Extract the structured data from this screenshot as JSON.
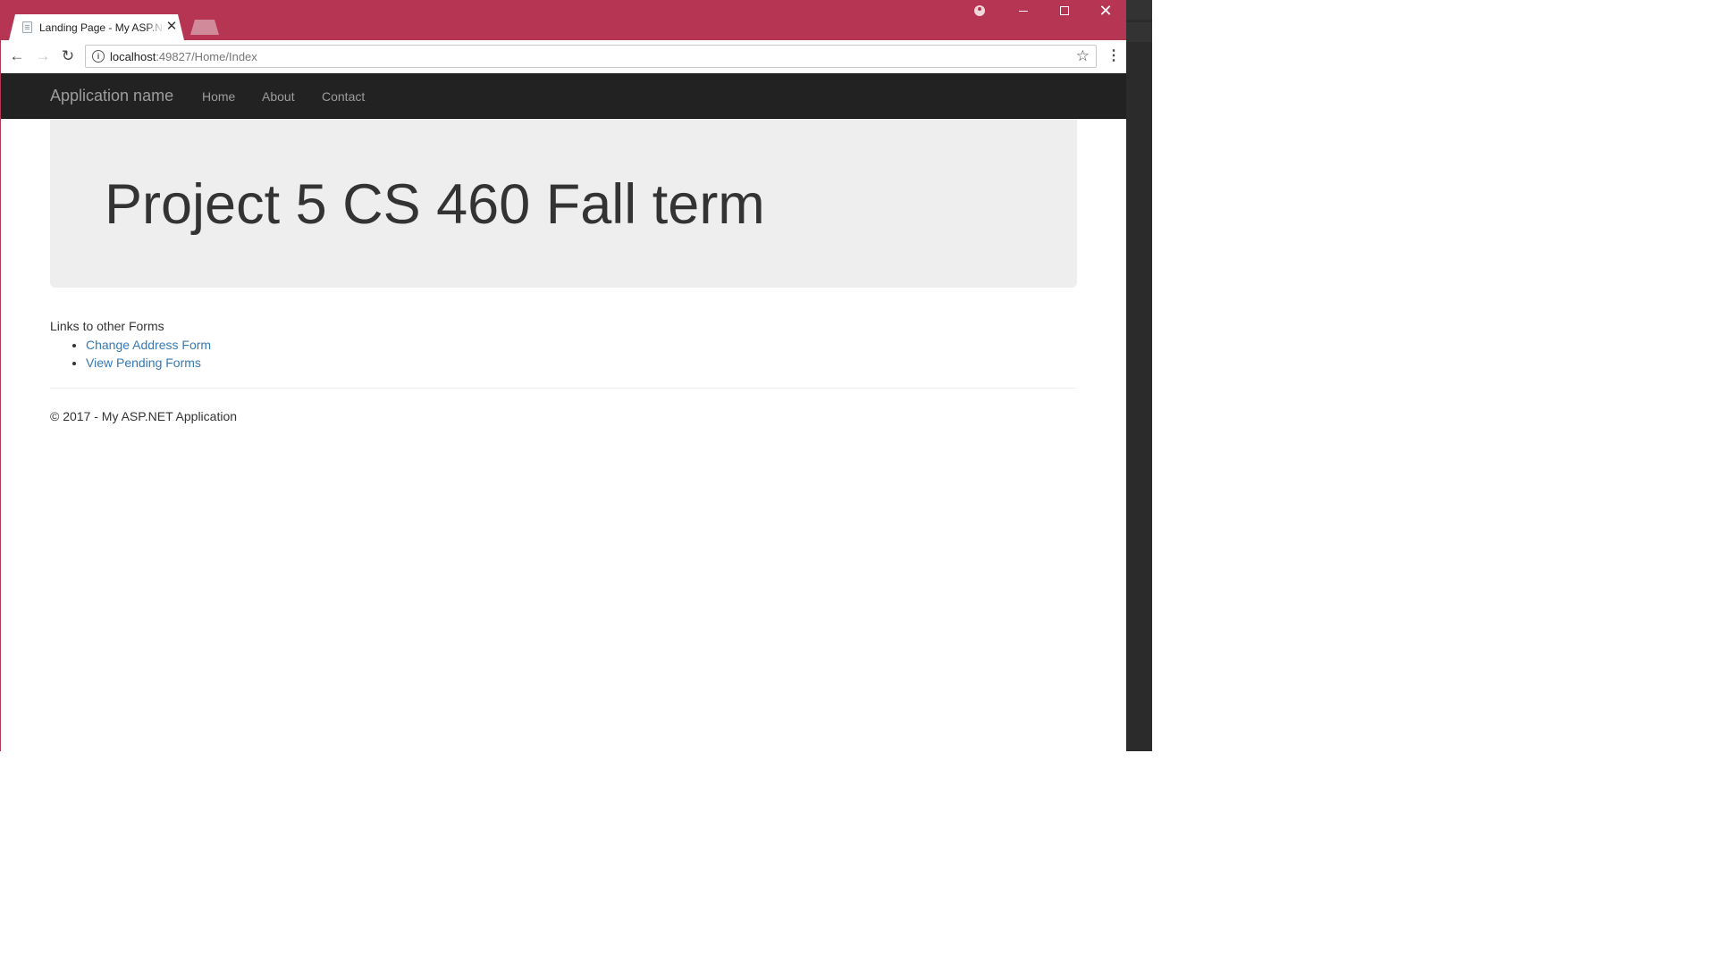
{
  "browser": {
    "tab_title": "Landing Page - My ASP.NET Application",
    "tab_close": "✕",
    "url_host": "localhost",
    "url_rest": ":49827/Home/Index",
    "window_controls": {
      "minimize": "—",
      "maximize": "☐",
      "close": "✕"
    },
    "frame_color": "#b63552"
  },
  "navbar": {
    "brand": "Application name",
    "links": [
      "Home",
      "About",
      "Contact"
    ]
  },
  "jumbotron": {
    "title": "Project 5 CS 460 Fall term"
  },
  "content": {
    "links_heading": "Links to other Forms",
    "links": [
      "Change Address Form",
      "View Pending Forms"
    ],
    "link_color": "#337ab7"
  },
  "footer": {
    "text": "© 2017 - My ASP.NET Application"
  }
}
